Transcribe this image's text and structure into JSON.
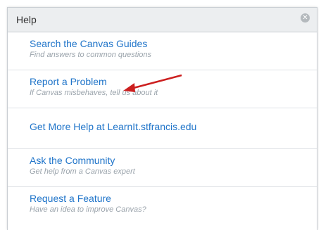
{
  "dialog": {
    "title": "Help",
    "close_icon": "close-icon",
    "items": [
      {
        "label": "Search the Canvas Guides",
        "description": "Find answers to common questions"
      },
      {
        "label": "Report a Problem",
        "description": "If Canvas misbehaves, tell us about it"
      },
      {
        "label": "Get More Help at LearnIt.stfrancis.edu"
      },
      {
        "label": "Ask the Community",
        "description": "Get help from a Canvas expert"
      },
      {
        "label": "Request a Feature",
        "description": "Have an idea to improve Canvas?"
      }
    ]
  },
  "annotation": {
    "arrow_color": "#cc1f1f"
  },
  "colors": {
    "link": "#1f74c9",
    "description": "#9aa3ab",
    "titlebar": "#eceef0"
  }
}
